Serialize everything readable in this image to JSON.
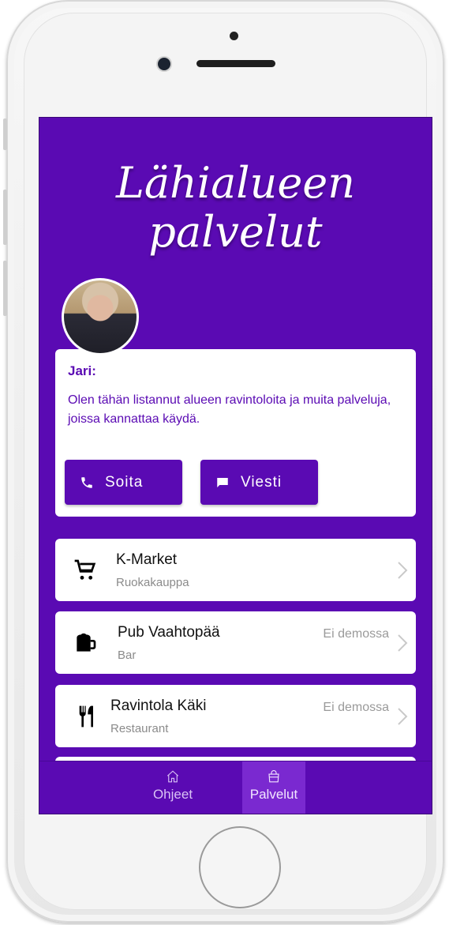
{
  "header": {
    "title_line1": "Lähialueen",
    "title_line2": "palvelut"
  },
  "host": {
    "name": "Jari:",
    "message": "Olen tähän listannut alueen ravintoloita ja muita palveluja, joissa kannattaa käydä.",
    "call_label": "Soita",
    "message_label": "Viesti"
  },
  "services": [
    {
      "name": "K-Market",
      "category": "Ruokakauppa",
      "status": "",
      "icon": "shopping-cart-icon"
    },
    {
      "name": "Pub Vaahtopää",
      "category": "Bar",
      "status": "Ei demossa",
      "icon": "beer-mug-icon"
    },
    {
      "name": "Ravintola Käki",
      "category": "Restaurant",
      "status": "Ei demossa",
      "icon": "fork-knife-icon"
    }
  ],
  "tabs": {
    "home": {
      "label": "Ohjeet",
      "icon": "home-icon"
    },
    "services": {
      "label": "Palvelut",
      "icon": "shopping-bag-icon",
      "active": true
    }
  },
  "colors": {
    "brand": "#5a0ab3",
    "active_tab": "#7a29d0"
  }
}
